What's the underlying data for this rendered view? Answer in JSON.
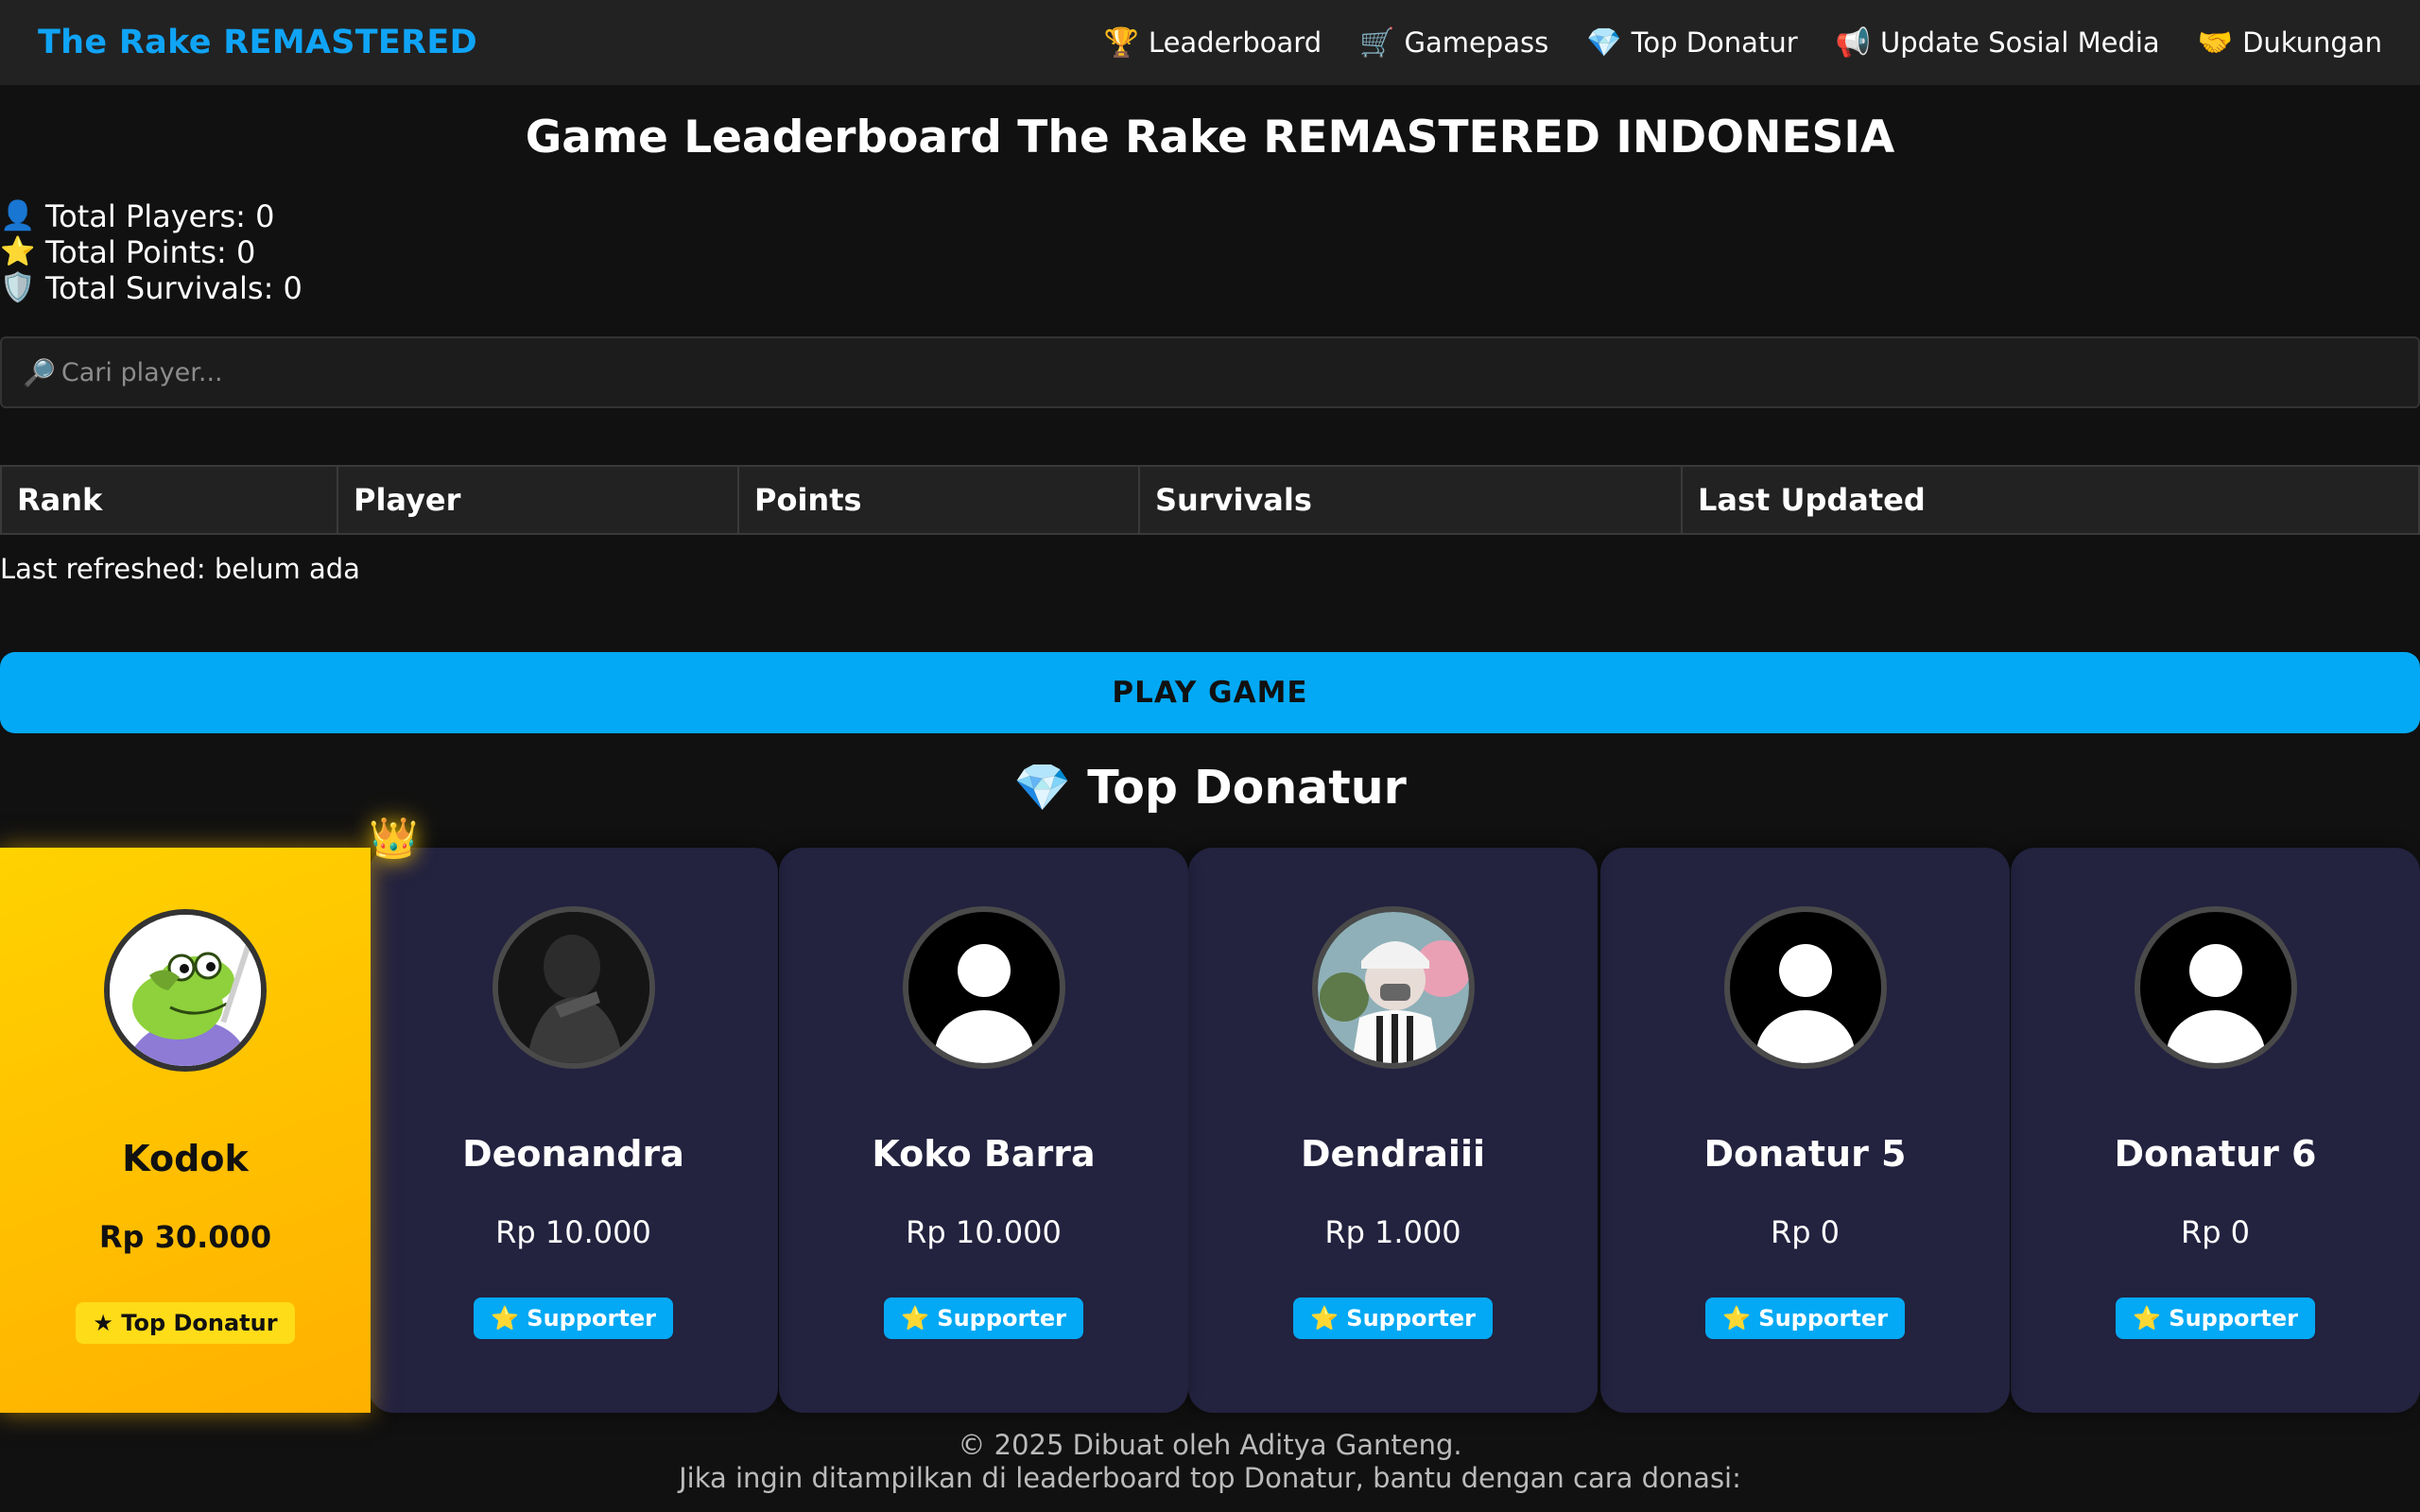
{
  "brand": "The Rake REMASTERED",
  "nav": [
    {
      "icon": "🏆",
      "label": "Leaderboard"
    },
    {
      "icon": "🛒",
      "label": "Gamepass"
    },
    {
      "icon": "💎",
      "label": "Top Donatur"
    },
    {
      "icon": "📢",
      "label": "Update Sosial Media"
    },
    {
      "icon": "🤝",
      "label": "Dukungan"
    }
  ],
  "page_title": "Game Leaderboard The Rake REMASTERED INDONESIA",
  "stats": [
    {
      "icon": "👤",
      "label": "Total Players: 0"
    },
    {
      "icon": "⭐",
      "label": "Total Points: 0"
    },
    {
      "icon": "🛡️",
      "label": "Total Survivals: 0"
    }
  ],
  "search": {
    "icon": "🔎",
    "placeholder": "Cari player..."
  },
  "table": {
    "headers": [
      "Rank",
      "Player",
      "Points",
      "Survivals",
      "Last Updated"
    ]
  },
  "last_refreshed": "Last refreshed: belum ada",
  "play_button": "PLAY GAME",
  "donor_section": {
    "title": "💎 Top Donatur",
    "crown_icon": "👑"
  },
  "donors": [
    {
      "name": "Kodok",
      "amount": "Rp 30.000",
      "badge": "★ Top Donatur",
      "avatar": "frog-avatar"
    },
    {
      "name": "Deonandra",
      "amount": "Rp 10.000",
      "badge": "⭐ Supporter",
      "avatar": "dark-photo-avatar"
    },
    {
      "name": "Koko Barra",
      "amount": "Rp 10.000",
      "badge": "⭐ Supporter",
      "avatar": "default-avatar"
    },
    {
      "name": "Dendraiii",
      "amount": "Rp 1.000",
      "badge": "⭐ Supporter",
      "avatar": "anime-avatar"
    },
    {
      "name": "Donatur 5",
      "amount": "Rp 0",
      "badge": "⭐ Supporter",
      "avatar": "default-avatar"
    },
    {
      "name": "Donatur 6",
      "amount": "Rp 0",
      "badge": "⭐ Supporter",
      "avatar": "default-avatar"
    }
  ],
  "footer": {
    "line1": "© 2025 Dibuat oleh Aditya Ganteng.",
    "line2": "Jika ingin ditampilkan di leaderboard top Donatur, bantu dengan cara donasi:"
  },
  "colors": {
    "accent": "#03a9f4",
    "brand": "#10a4f6",
    "gold": "#ffc400",
    "card": "#23223f"
  }
}
